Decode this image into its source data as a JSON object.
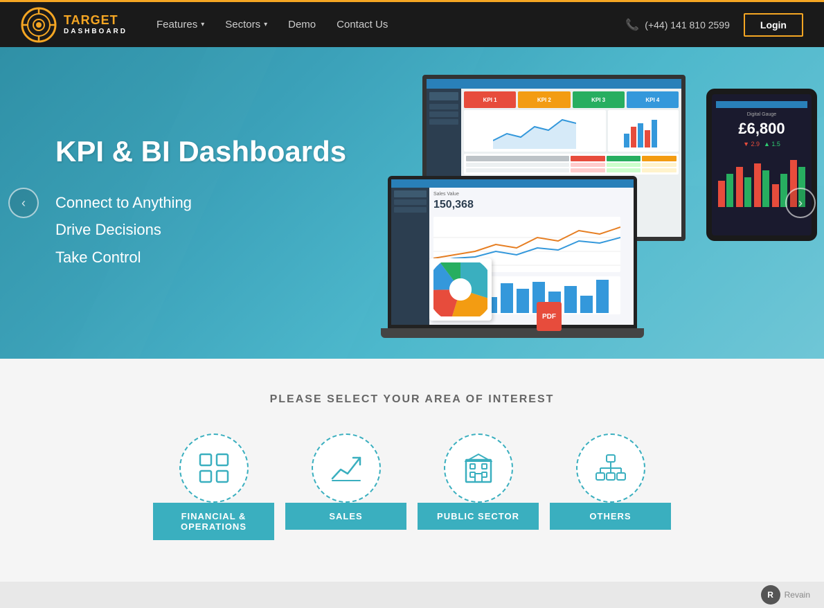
{
  "navbar": {
    "logo_target": "TARGET",
    "logo_dashboard": "DASHBOARD",
    "nav_items": [
      {
        "label": "Features",
        "has_arrow": true
      },
      {
        "label": "Sectors",
        "has_arrow": true
      },
      {
        "label": "Demo",
        "has_arrow": false
      },
      {
        "label": "Contact Us",
        "has_arrow": false
      }
    ],
    "phone": "(+44) 141 810 2599",
    "login_label": "Login"
  },
  "hero": {
    "title": "KPI & BI Dashboards",
    "line1": "Connect to Anything",
    "line2": "Drive Decisions",
    "line3": "Take Control",
    "arrow_left": "‹",
    "arrow_right": "›",
    "tablet_label": "Digital Gauge",
    "tablet_value": "£6,800",
    "tablet_down": "▼ 2.9",
    "tablet_up": "▲ 1.5",
    "sales_value": "150,368"
  },
  "interest": {
    "title": "PLEASE SELECT YOUR AREA OF INTEREST",
    "cards": [
      {
        "id": "financial",
        "label": "FINANCIAL &\nOPERATIONS",
        "icon": "grid"
      },
      {
        "id": "sales",
        "label": "SALES",
        "icon": "trend"
      },
      {
        "id": "public",
        "label": "PUBLIC SECTOR",
        "icon": "building"
      },
      {
        "id": "others",
        "label": "OTHERS",
        "icon": "org"
      }
    ]
  },
  "bottom": {
    "revain_label": "Revain"
  }
}
